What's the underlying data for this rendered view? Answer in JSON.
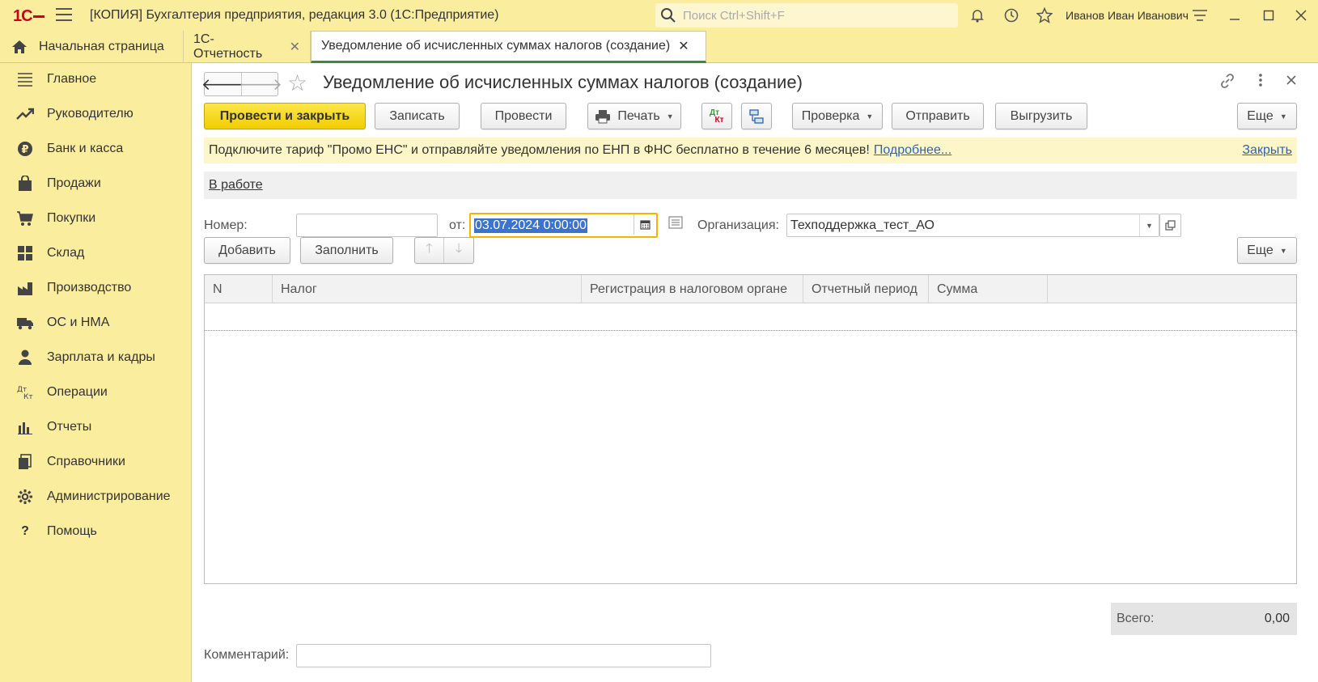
{
  "app": {
    "logo": "1С",
    "title": "[КОПИЯ] Бухгалтерия предприятия, редакция 3.0  (1С:Предприятие)",
    "search_placeholder": "Поиск Ctrl+Shift+F",
    "user": "Иванов Иван Иванович"
  },
  "tabs": [
    {
      "label": "Начальная страница"
    },
    {
      "label": "1С-Отчетность"
    },
    {
      "label": "Уведомление об исчисленных суммах налогов (создание)"
    }
  ],
  "sidebar": {
    "items": [
      {
        "label": "Главное",
        "icon": "menu-lines-icon"
      },
      {
        "label": "Руководителю",
        "icon": "trend-up-icon"
      },
      {
        "label": "Банк и касса",
        "icon": "ruble-icon"
      },
      {
        "label": "Продажи",
        "icon": "shopping-bag-icon"
      },
      {
        "label": "Покупки",
        "icon": "cart-icon"
      },
      {
        "label": "Склад",
        "icon": "warehouse-grid-icon"
      },
      {
        "label": "Производство",
        "icon": "factory-icon"
      },
      {
        "label": "ОС и НМА",
        "icon": "truck-icon"
      },
      {
        "label": "Зарплата и кадры",
        "icon": "person-icon"
      },
      {
        "label": "Операции",
        "icon": "debit-credit-icon"
      },
      {
        "label": "Отчеты",
        "icon": "bar-chart-icon"
      },
      {
        "label": "Справочники",
        "icon": "books-icon"
      },
      {
        "label": "Администрирование",
        "icon": "gear-icon"
      },
      {
        "label": "Помощь",
        "icon": "question-icon"
      }
    ]
  },
  "document": {
    "title": "Уведомление об исчисленных суммах налогов (создание)",
    "toolbar": {
      "post_close": "Провести и закрыть",
      "save": "Записать",
      "post": "Провести",
      "print": "Печать",
      "dtkt_top": "Дт",
      "dtkt_bottom": "Кт",
      "check": "Проверка",
      "send": "Отправить",
      "export": "Выгрузить",
      "more": "Еще"
    },
    "banner": {
      "text": "Подключите тариф \"Промо ЕНС\" и отправляйте уведомления по ЕНП в ФНС бесплатно в течение 6 месяцев!",
      "link": "Подробнее...",
      "close": "Закрыть"
    },
    "status": "В работе",
    "fields": {
      "number_label": "Номер:",
      "number_value": "",
      "date_label": "от:",
      "date_value": "03.07.2024  0:00:00",
      "org_label": "Организация:",
      "org_value": "Техподдержка_тест_АО"
    },
    "table_toolbar": {
      "add": "Добавить",
      "fill": "Заполнить",
      "more": "Еще"
    },
    "table": {
      "columns": [
        "N",
        "Налог",
        "Регистрация в налоговом органе",
        "Отчетный период",
        "Сумма"
      ],
      "rows": []
    },
    "total": {
      "label": "Всего:",
      "value": "0,00"
    },
    "comment": {
      "label": "Комментарий:",
      "value": ""
    }
  }
}
